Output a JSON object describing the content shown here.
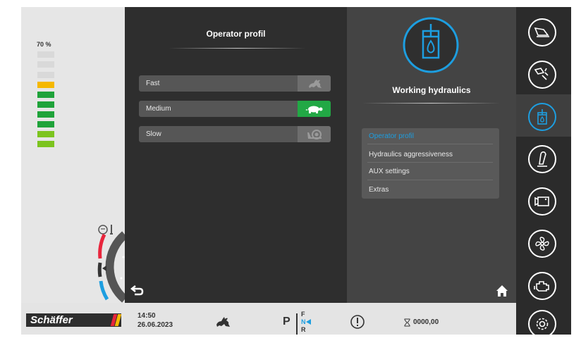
{
  "fuel": {
    "percent_label": "70 %",
    "level_percent": 70
  },
  "operator_profile": {
    "title": "Operator profil",
    "options": [
      {
        "label": "Fast",
        "icon": "rabbit-icon",
        "selected": false
      },
      {
        "label": "Medium",
        "icon": "turtle-icon",
        "selected": true
      },
      {
        "label": "Slow",
        "icon": "snail-icon",
        "selected": false
      }
    ]
  },
  "working_hydraulics": {
    "title": "Working hydraulics",
    "icon": "hydraulic-cylinder-icon",
    "menu": [
      {
        "label": "Operator profil",
        "active": true
      },
      {
        "label": "Hydraulics aggressiveness",
        "active": false
      },
      {
        "label": "AUX settings",
        "active": false
      },
      {
        "label": "Extras",
        "active": false
      }
    ]
  },
  "sidebar": {
    "items": [
      {
        "icon": "bucket-icon",
        "active": false
      },
      {
        "icon": "bucket-tilt-icon",
        "active": false
      },
      {
        "icon": "hydraulic-cylinder-icon",
        "active": true
      },
      {
        "icon": "joystick-icon",
        "active": false
      },
      {
        "icon": "camera-icon",
        "active": false
      },
      {
        "icon": "fan-icon",
        "active": false
      },
      {
        "icon": "engine-icon",
        "active": false
      },
      {
        "icon": "settings-icon",
        "active": false
      }
    ]
  },
  "status": {
    "brand": "Schäffer",
    "time": "14:50",
    "date": "26.06.2023",
    "speed_mode_icon": "rabbit-icon",
    "parking": "P",
    "gear_f": "F",
    "gear_n": "N",
    "gear_r": "R",
    "warning_icon": "warning-icon",
    "hours": "0000,00",
    "hours_icon": "hourglass-icon"
  },
  "colors": {
    "accent": "#1d9ee0",
    "active_green": "#22a845",
    "fuel_yellow": "#f5b800",
    "fuel_green": "#1fa33a"
  }
}
